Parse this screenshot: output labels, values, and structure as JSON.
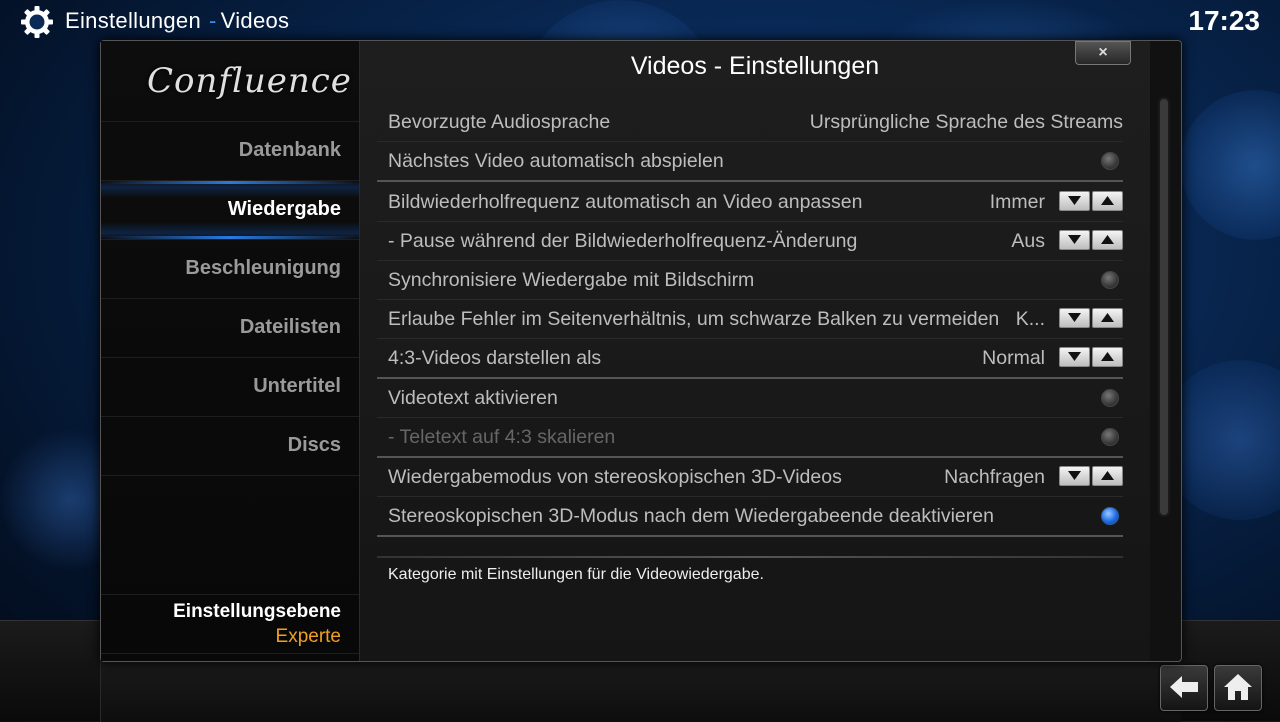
{
  "header": {
    "section": "Einstellungen",
    "separator": "-",
    "page": "Videos",
    "clock": "17:23"
  },
  "dialog": {
    "title": "Videos - Einstellungen",
    "close_label": "×",
    "logo": "Confluence"
  },
  "sidebar": {
    "items": [
      {
        "label": "Datenbank"
      },
      {
        "label": "Wiedergabe"
      },
      {
        "label": "Beschleunigung"
      },
      {
        "label": "Dateilisten"
      },
      {
        "label": "Untertitel"
      },
      {
        "label": "Discs"
      }
    ],
    "active_index": 1,
    "level_title": "Einstellungsebene",
    "level_value": "Experte"
  },
  "settings": [
    {
      "label": "Bevorzugte Audiosprache",
      "value": "Ursprüngliche Sprache des Streams",
      "type": "text"
    },
    {
      "label": "Nächstes Video automatisch abspielen",
      "type": "toggle",
      "on": false
    },
    {
      "label": "Bildwiederholfrequenz automatisch an Video anpassen",
      "value": "Immer",
      "type": "spinner"
    },
    {
      "label": "- Pause während der Bildwiederholfrequenz-Änderung",
      "value": "Aus",
      "type": "spinner"
    },
    {
      "label": "Synchronisiere Wiedergabe mit Bildschirm",
      "type": "toggle",
      "on": false
    },
    {
      "label": "Erlaube Fehler im Seitenverhältnis, um schwarze Balken zu vermeiden",
      "value": "K...",
      "type": "spinner"
    },
    {
      "label": "4:3-Videos darstellen als",
      "value": "Normal",
      "type": "spinner"
    },
    {
      "label": "Videotext aktivieren",
      "type": "toggle",
      "on": false
    },
    {
      "label": "- Teletext auf 4:3 skalieren",
      "type": "toggle",
      "on": false,
      "disabled": true
    },
    {
      "label": "Wiedergabemodus von stereoskopischen 3D-Videos",
      "value": "Nachfragen",
      "type": "spinner"
    },
    {
      "label": "Stereoskopischen 3D-Modus nach dem Wiedergabeende deaktivieren",
      "type": "toggle",
      "on": true
    }
  ],
  "description": "Kategorie mit Einstellungen für die Videowiedergabe.",
  "colors": {
    "accent": "#1e6ee6",
    "level_value": "#f0a020"
  },
  "icons": {
    "header": "gear-icon",
    "back": "back-arrow-icon",
    "home": "home-icon"
  }
}
